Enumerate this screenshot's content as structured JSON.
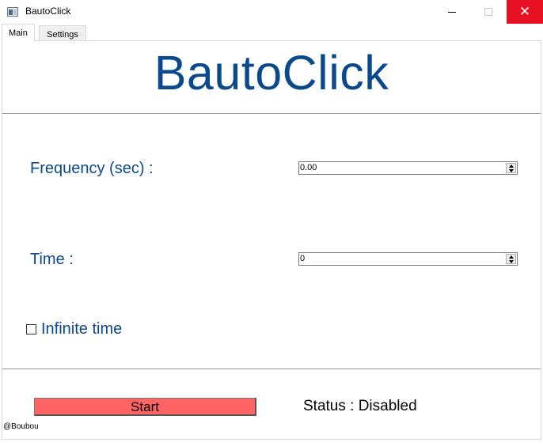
{
  "window": {
    "title": "BautoClick",
    "close_glyph": "✕"
  },
  "tabs": [
    {
      "label": "Main",
      "selected": true
    },
    {
      "label": "Settings",
      "selected": false
    }
  ],
  "main": {
    "heading": "BautoClick",
    "frequency": {
      "label": "Frequency (sec) :",
      "value": "0.00"
    },
    "time": {
      "label": "Time :",
      "value": "0"
    },
    "infinite_time": {
      "label": "Infinite time",
      "checked": false
    },
    "start_label": "Start",
    "status": "Status : Disabled",
    "credit": "@Boubou"
  },
  "colors": {
    "heading": "#0a4a8c",
    "start_button": "#ff6464",
    "close_button": "#e81123"
  }
}
